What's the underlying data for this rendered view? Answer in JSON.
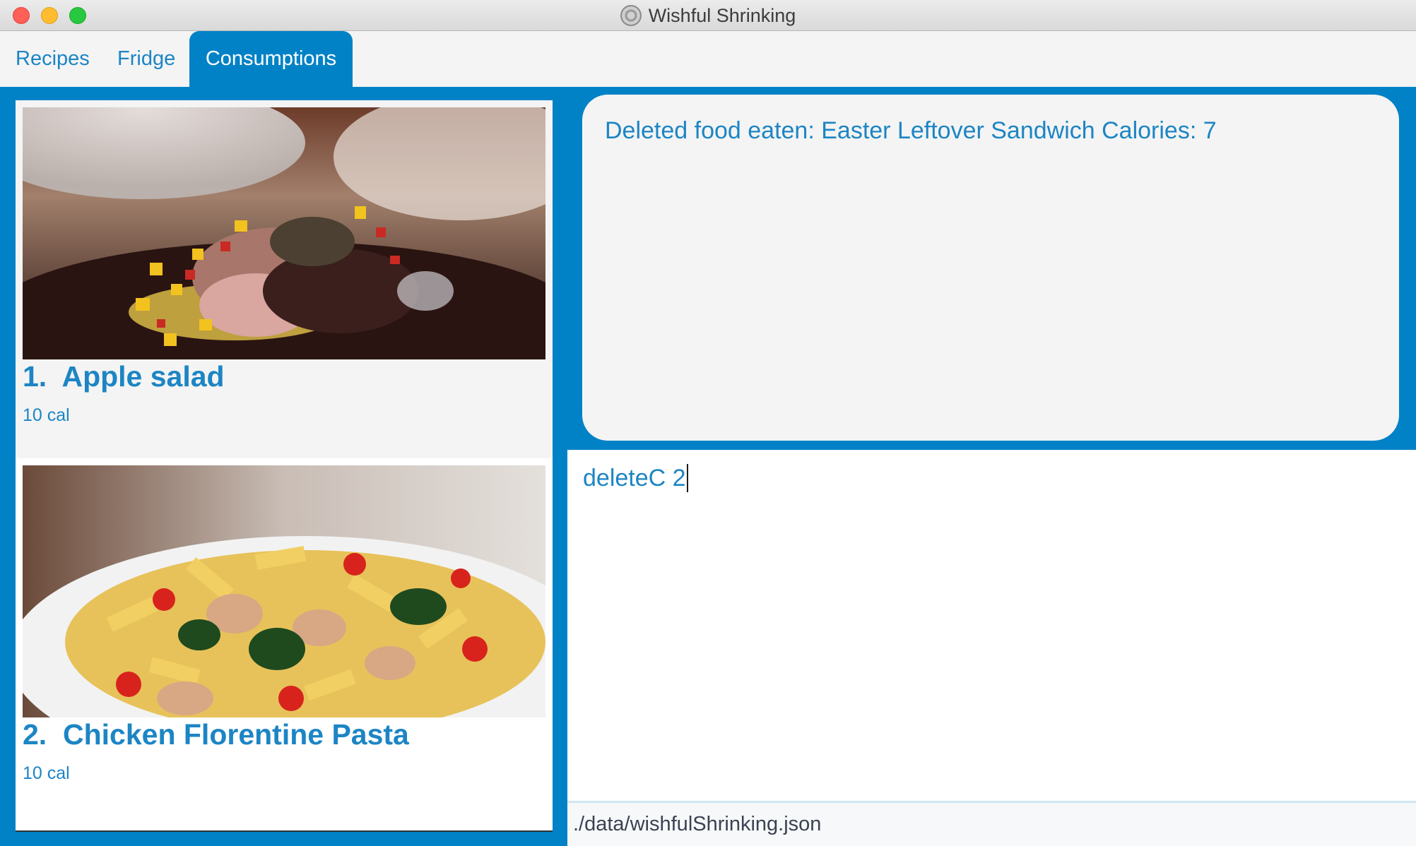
{
  "window": {
    "title": "Wishful Shrinking",
    "controls": [
      "close",
      "minimize",
      "maximize"
    ]
  },
  "tabs": [
    {
      "label": "Recipes",
      "active": false
    },
    {
      "label": "Fridge",
      "active": false
    },
    {
      "label": "Consumptions",
      "active": true
    }
  ],
  "consumption_list": [
    {
      "index": "1.",
      "name": "Apple salad",
      "calories": "10 cal",
      "image": "roast-pork-with-diced-vegetables-photo"
    },
    {
      "index": "2.",
      "name": "Chicken Florentine Pasta",
      "calories": "10 cal",
      "image": "penne-pasta-with-chicken-spinach-tomatoes-photo"
    }
  ],
  "result_display": {
    "message": "Deleted food eaten: Easter Leftover Sandwich Calories: 7"
  },
  "command_box": {
    "value": "deleteC 2"
  },
  "status_bar": {
    "file_path": "./data/wishfulShrinking.json"
  },
  "colors": {
    "accent": "#0282c6",
    "text_blue": "#1c85c4",
    "panel": "#f4f4f4"
  }
}
